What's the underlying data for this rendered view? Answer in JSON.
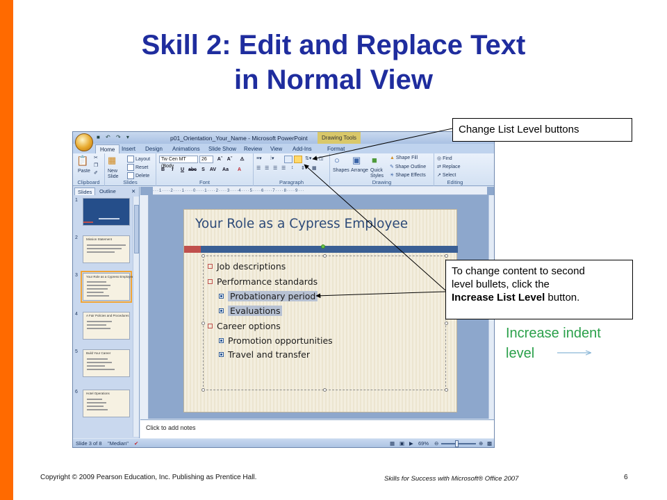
{
  "slide": {
    "title_line1": "Skill 2: Edit and Replace Text",
    "title_line2": "in Normal View",
    "footer_copyright": "Copyright © 2009 Pearson Education, Inc. Publishing as Prentice Hall.",
    "footer_book": "Skills for Success with Microsoft® Office 2007",
    "page_number": "6"
  },
  "callouts": {
    "list_level": "Change List Level buttons",
    "increase_line1": "To change content to second",
    "increase_line2": "level bullets, click the",
    "increase_bold": "Increase List Level",
    "increase_tail": "button.",
    "indent_note": "Increase indent level"
  },
  "app": {
    "window_title": "p01_Orientation_Your_Name - Microsoft PowerPoint",
    "context_tab": "Drawing Tools",
    "tabs": [
      "Home",
      "Insert",
      "Design",
      "Animations",
      "Slide Show",
      "Review",
      "View",
      "Add-Ins",
      "Format"
    ],
    "active_tab": "Home",
    "groups": [
      "Clipboard",
      "Slides",
      "Font",
      "Paragraph",
      "Drawing",
      "Editing"
    ],
    "clipboard": {
      "paste": "Paste"
    },
    "slides": {
      "new_slide": "New Slide",
      "layout": "Layout",
      "reset": "Reset",
      "delete": "Delete"
    },
    "font": {
      "family": "Tw Cen MT (Body",
      "size": "26"
    },
    "drawing": {
      "shapes": "Shapes",
      "arrange": "Arrange",
      "quick_styles": "Quick Styles",
      "fill": "Shape Fill",
      "outline": "Shape Outline",
      "effects": "Shape Effects"
    },
    "editing": {
      "find": "Find",
      "replace": "Replace",
      "select": "Select"
    },
    "pane_tabs": [
      "Slides",
      "Outline"
    ],
    "thumb_numbers": [
      "1",
      "2",
      "3",
      "4",
      "5",
      "6"
    ],
    "thumb_titles": [
      "",
      "Mission Statement",
      "Your Role as a Cypress Employee",
      "A Fair Policies and Procedures",
      "Build Your Career",
      "Hotel Operations"
    ],
    "notes_placeholder": "Click to add notes",
    "status": {
      "slide": "Slide 3 of 8",
      "theme": "\"Median\"",
      "zoom": "69%"
    },
    "slide_title": "Your Role as a Cypress Employee",
    "bullets": [
      {
        "level": 1,
        "text": "Job descriptions"
      },
      {
        "level": 1,
        "text": "Performance standards"
      },
      {
        "level": 2,
        "text": "Probationary period"
      },
      {
        "level": 2,
        "text": "Evaluations"
      },
      {
        "level": 1,
        "text": "Career options"
      },
      {
        "level": 2,
        "text": "Promotion opportunities"
      },
      {
        "level": 2,
        "text": "Travel and transfer"
      }
    ]
  },
  "colors": {
    "accent_orange": "#ff6a00",
    "title_blue": "#1f2d9e",
    "indent_green": "#2aa04a"
  }
}
